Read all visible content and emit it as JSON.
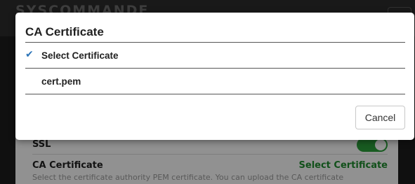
{
  "background": {
    "brand": "SYSCOMMANDE",
    "ssl_label": "SSL",
    "ca_label": "CA Certificate",
    "ca_action": "Select Certificate",
    "ca_description": "Select the certificate authority PEM certificate. You can upload the CA certificate",
    "ssl_enabled": true,
    "accent_green": "#1e8a2e"
  },
  "modal": {
    "title": "CA Certificate",
    "options": [
      {
        "label": "Select Certificate",
        "selected": true,
        "icon": "checkmark-icon"
      },
      {
        "label": "cert.pem",
        "selected": false
      }
    ],
    "check_glyph": "✔",
    "cancel_label": "Cancel",
    "check_color": "#2d75b8"
  }
}
